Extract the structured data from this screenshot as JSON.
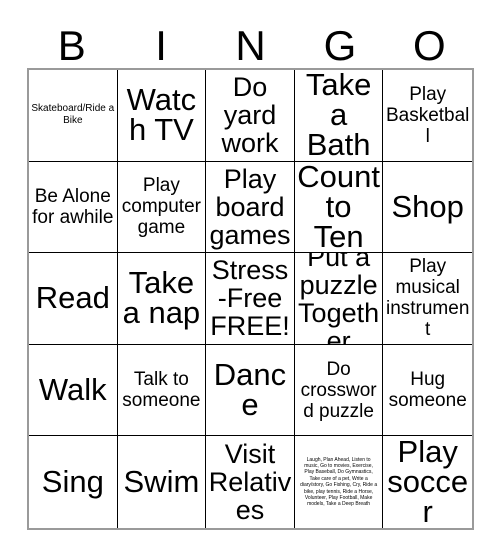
{
  "header": {
    "letters": [
      "B",
      "I",
      "N",
      "G",
      "O"
    ]
  },
  "grid": {
    "rows": 5,
    "columns": 5,
    "cells": [
      {
        "text": "Skateboard/Ride a Bike",
        "size": "s-xs"
      },
      {
        "text": "Watch TV",
        "size": "s-xl"
      },
      {
        "text": "Do yard work",
        "size": "s-lg"
      },
      {
        "text": "Take a Bath",
        "size": "s-xl"
      },
      {
        "text": "Play Basketball",
        "size": "s-md"
      },
      {
        "text": "Be Alone for awhile",
        "size": "s-md"
      },
      {
        "text": "Play computer game",
        "size": "s-md"
      },
      {
        "text": "Play board games",
        "size": "s-lg"
      },
      {
        "text": "Count to Ten",
        "size": "s-xl"
      },
      {
        "text": "Shop",
        "size": "s-xl"
      },
      {
        "text": "Read",
        "size": "s-xl"
      },
      {
        "text": "Take a nap",
        "size": "s-xl"
      },
      {
        "text": "Stress-Free FREE!",
        "size": "s-lg"
      },
      {
        "text": "Put a puzzle Together",
        "size": "s-lg"
      },
      {
        "text": "Play musical instrument",
        "size": "s-md"
      },
      {
        "text": "Walk",
        "size": "s-xl"
      },
      {
        "text": "Talk to someone",
        "size": "s-md"
      },
      {
        "text": "Dance",
        "size": "s-xl"
      },
      {
        "text": "Do crossword puzzle",
        "size": "s-md"
      },
      {
        "text": "Hug someone",
        "size": "s-md"
      },
      {
        "text": "Sing",
        "size": "s-xl"
      },
      {
        "text": "Swim",
        "size": "s-xl"
      },
      {
        "text": "Visit Relatives",
        "size": "s-lg"
      },
      {
        "text": "Laugh, Plan Ahead, Listen to music, Go to movies, Exercise, Play Baseball, Do Gymnastics, Take care of a pet, Write a diary/story, Go Fishing, Cry, Ride a bike, play tennis, Ride a Horse, Volunteer, Play Football, Make models, Take a Deep Breath",
        "size": "s-tiny"
      },
      {
        "text": "Play soccer",
        "size": "s-xl"
      }
    ]
  },
  "colors": {
    "background": "#ffffff",
    "text": "#000000",
    "cell_border": "#000000",
    "outer_border": "#9a9a9a"
  }
}
